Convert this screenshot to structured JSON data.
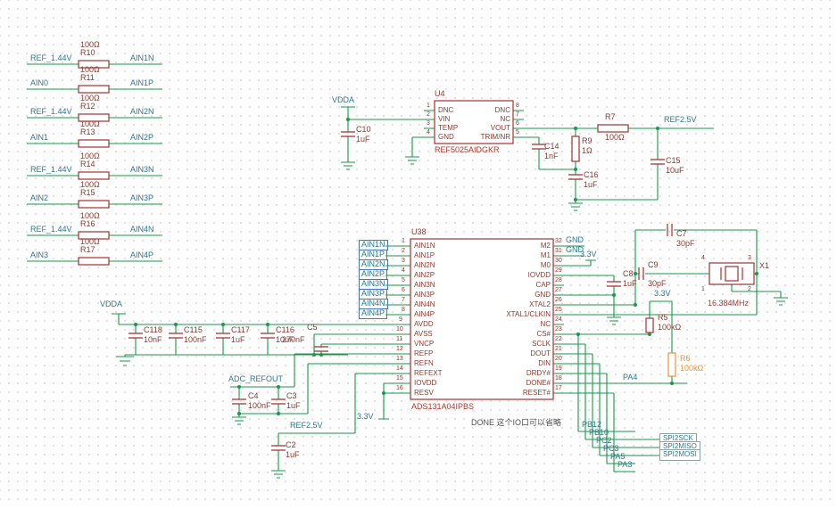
{
  "colors": {
    "wire": "#19984b",
    "symbol_outline": "#a03333",
    "net_label": "#2d7a8c",
    "reference_text": "#8c3b32",
    "part_text": "#b03a2e",
    "highlight": "#f09235"
  },
  "resistor_array": {
    "rows": [
      {
        "left": "REF_1.44V",
        "right": "AIN1N",
        "ref": "R10",
        "value": "100Ω"
      },
      {
        "left": "AIN0",
        "right": "AIN1P",
        "ref": "R11",
        "value": "100Ω"
      },
      {
        "left": "REF_1.44V",
        "right": "AIN2N",
        "ref": "R12",
        "value": "100Ω"
      },
      {
        "left": "AIN1",
        "right": "AIN2P",
        "ref": "R13",
        "value": "100Ω"
      },
      {
        "left": "REF_1.44V",
        "right": "AIN3N",
        "ref": "R14",
        "value": "100Ω"
      },
      {
        "left": "AIN2",
        "right": "AIN3P",
        "ref": "R15",
        "value": "100Ω"
      },
      {
        "left": "REF_1.44V",
        "right": "AIN4N",
        "ref": "R16",
        "value": "100Ω"
      },
      {
        "left": "AIN3",
        "right": "AIN4P",
        "ref": "R17",
        "value": "100Ω"
      }
    ]
  },
  "vref": {
    "ref": "U4",
    "part": "REF5025AIDGKR",
    "pins_left": [
      {
        "num": "1",
        "name": "DNC"
      },
      {
        "num": "2",
        "name": "VIN"
      },
      {
        "num": "3",
        "name": "TEMP"
      },
      {
        "num": "4",
        "name": "GND"
      }
    ],
    "pins_right": [
      {
        "num": "8",
        "name": "DNC"
      },
      {
        "num": "7",
        "name": "NC"
      },
      {
        "num": "6",
        "name": "VOUT"
      },
      {
        "num": "5",
        "name": "TRIM/NR"
      }
    ],
    "vdda": "VDDA",
    "ref25": "REF2.5V",
    "c10": {
      "ref": "C10",
      "value": "1uF"
    },
    "c14": {
      "ref": "C14",
      "value": "1nF"
    },
    "r9": {
      "ref": "R9",
      "value": "1Ω"
    },
    "c16": {
      "ref": "C16",
      "value": "1uF"
    },
    "r7": {
      "ref": "R7",
      "value": "100Ω"
    },
    "c15": {
      "ref": "C15",
      "value": "10uF"
    }
  },
  "adc": {
    "ref": "U38",
    "part": "ADS131A04IPBS",
    "pins_left": [
      {
        "num": "1",
        "name": "AIN1N"
      },
      {
        "num": "2",
        "name": "AIN1P"
      },
      {
        "num": "3",
        "name": "AIN2N"
      },
      {
        "num": "4",
        "name": "AIN2P"
      },
      {
        "num": "5",
        "name": "AIN3N"
      },
      {
        "num": "6",
        "name": "AIN3P"
      },
      {
        "num": "7",
        "name": "AIN4N"
      },
      {
        "num": "8",
        "name": "AIN4P"
      },
      {
        "num": "9",
        "name": "AVDD"
      },
      {
        "num": "10",
        "name": "AVSS"
      },
      {
        "num": "11",
        "name": "VNCP"
      },
      {
        "num": "12",
        "name": "REFP"
      },
      {
        "num": "13",
        "name": "REFN"
      },
      {
        "num": "14",
        "name": "REFEXT"
      },
      {
        "num": "15",
        "name": "IOVDD"
      },
      {
        "num": "16",
        "name": "RESV"
      }
    ],
    "pins_right": [
      {
        "num": "32",
        "name": "M2"
      },
      {
        "num": "31",
        "name": "M1"
      },
      {
        "num": "30",
        "name": "M0"
      },
      {
        "num": "29",
        "name": "IOVDD"
      },
      {
        "num": "28",
        "name": "CAP"
      },
      {
        "num": "27",
        "name": "GND"
      },
      {
        "num": "26",
        "name": "XTAL2"
      },
      {
        "num": "25",
        "name": "XTAL1/CLKIN"
      },
      {
        "num": "24",
        "name": "NC"
      },
      {
        "num": "23",
        "name": "CS#"
      },
      {
        "num": "22",
        "name": "SCLK"
      },
      {
        "num": "21",
        "name": "DOUT"
      },
      {
        "num": "20",
        "name": "DIN"
      },
      {
        "num": "19",
        "name": "DRDY#"
      },
      {
        "num": "18",
        "name": "DONE#"
      },
      {
        "num": "17",
        "name": "RESET#"
      }
    ],
    "input_nets": [
      "AIN1N",
      "AIN1P",
      "AIN2N",
      "AIN2P",
      "AIN3N",
      "AIN3P",
      "AIN4N",
      "AIN4P"
    ]
  },
  "analog": {
    "vdda": "VDDA",
    "c118": {
      "ref": "C118",
      "value": "10nF"
    },
    "c115": {
      "ref": "C115",
      "value": "100nF"
    },
    "c117": {
      "ref": "C117",
      "value": "1uF"
    },
    "c116": {
      "ref": "C116",
      "value": "10uF"
    },
    "c5": {
      "ref": "C5",
      "value": "270nF"
    },
    "adc_refout": "ADC_REFOUT",
    "c4": {
      "ref": "C4",
      "value": "100nF"
    },
    "c3": {
      "ref": "C3",
      "value": "1uF"
    },
    "v33": "3.3V",
    "ref25": "REF2.5V",
    "c2": {
      "ref": "C2",
      "value": "1uF"
    }
  },
  "digital": {
    "gnd_a": "GND",
    "gnd_b": "GND",
    "v33_m0": "3.3V",
    "c8": {
      "ref": "C8",
      "value": "1uF"
    },
    "c9": {
      "ref": "C9",
      "value": "30pF"
    },
    "c7": {
      "ref": "C7",
      "value": "30pF"
    },
    "x1": {
      "ref": "X1",
      "value": "16.384MHz",
      "pins": [
        "1",
        "2",
        "3",
        "4"
      ]
    },
    "v33_pull": "3.3V",
    "r5": {
      "ref": "R5",
      "value": "100kΩ"
    },
    "r6": {
      "ref": "R6",
      "value": "100kΩ"
    },
    "pa4": "PA4",
    "note": "DONE 这个IO口可以省略",
    "mcu_nets": [
      "PB12",
      "PB10",
      "PC2",
      "PC3",
      "PA5",
      "PA3"
    ],
    "spi_ports": [
      "SPI2SCK",
      "SPI2MISO",
      "SPI2MOSI"
    ]
  }
}
